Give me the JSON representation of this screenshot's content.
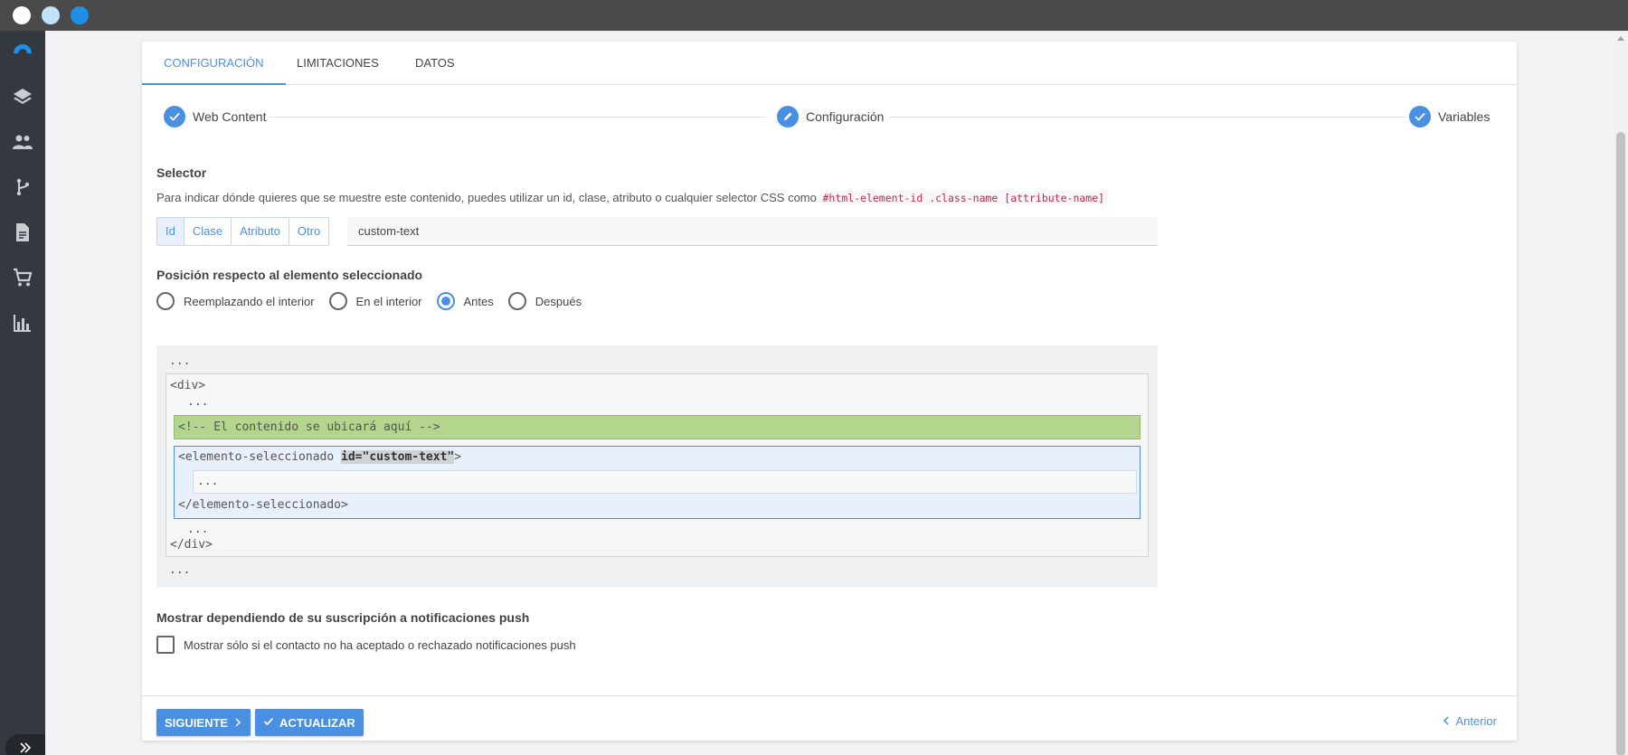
{
  "tabs": [
    {
      "label": "CONFIGURACIÓN",
      "active": true
    },
    {
      "label": "LIMITACIONES",
      "active": false
    },
    {
      "label": "DATOS",
      "active": false
    }
  ],
  "stepper": [
    {
      "label": "Web Content",
      "state": "done"
    },
    {
      "label": "Configuración",
      "state": "editing"
    },
    {
      "label": "Variables",
      "state": "done"
    }
  ],
  "selector": {
    "title": "Selector",
    "help_text": "Para indicar dónde quieres que se muestre este contenido, puedes utilizar un id, clase, atributo o cualquier selector CSS como",
    "help_code": "#html-element-id .class-name [attribute-name]",
    "types": [
      "Id",
      "Clase",
      "Atributo",
      "Otro"
    ],
    "active_type": "Id",
    "value": "custom-text"
  },
  "position": {
    "title": "Posición respecto al elemento seleccionado",
    "options": [
      "Reemplazando el interior",
      "En el interior",
      "Antes",
      "Después"
    ],
    "selected": "Antes"
  },
  "preview": {
    "ellipsis": "...",
    "div_open": "<div>",
    "div_close": "</div>",
    "placeholder": "<!-- El contenido se ubicará aquí -->",
    "element_open_start": "<elemento-seleccionado ",
    "element_attr": "id=\"custom-text\"",
    "element_open_end": ">",
    "element_close": "</elemento-seleccionado>"
  },
  "push": {
    "title": "Mostrar dependiendo de su suscripción a notificaciones push",
    "checkbox_label": "Mostrar sólo si el contacto no ha aceptado o rechazado notificaciones push",
    "checked": false
  },
  "footer": {
    "next_label": "SIGUIENTE",
    "update_label": "ACTUALIZAR",
    "back_label": "Anterior"
  },
  "colors": {
    "accent": "#4a90e2",
    "sidebar": "#34393f",
    "titlebar": "#4a4a4a",
    "placeholder_green": "#b3d58e"
  },
  "icons": {
    "nav": [
      "brand-logo-icon",
      "layers-icon",
      "users-icon",
      "branch-icon",
      "document-icon",
      "cart-icon",
      "bar-chart-icon"
    ],
    "expand": "double-chevron-right-icon"
  }
}
